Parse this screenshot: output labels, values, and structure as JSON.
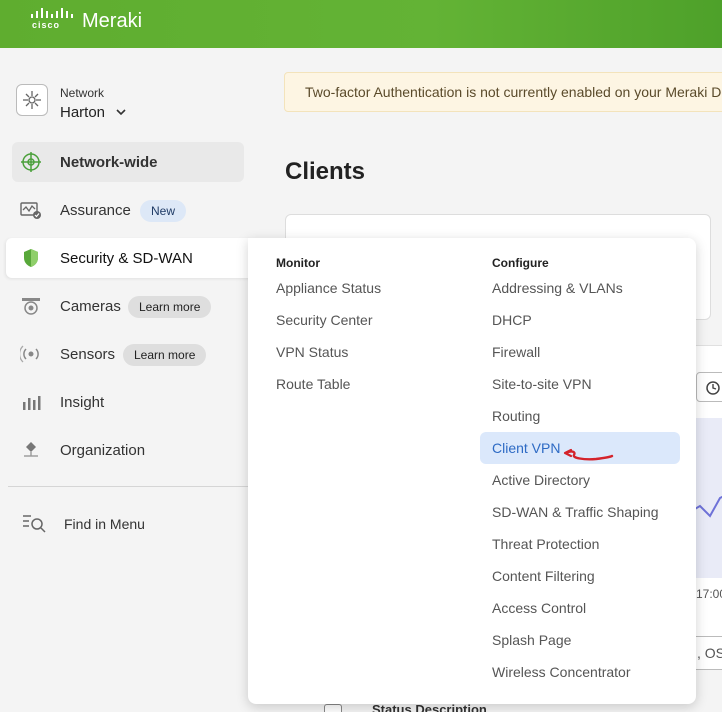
{
  "header": {
    "logo_text": "cisco",
    "brand": "Meraki",
    "colors": {
      "bar": "#5fad2f"
    }
  },
  "sidebar": {
    "network_label": "Network",
    "network_name": "Harton",
    "items": [
      {
        "label": "Network-wide",
        "icon": "network-wide-icon"
      },
      {
        "label": "Assurance",
        "icon": "assurance-icon",
        "badge": "New"
      },
      {
        "label": "Security & SD-WAN",
        "icon": "shield-icon"
      },
      {
        "label": "Cameras",
        "icon": "camera-icon",
        "badge": "Learn more"
      },
      {
        "label": "Sensors",
        "icon": "sensor-icon",
        "badge": "Learn more"
      },
      {
        "label": "Insight",
        "icon": "insight-chart-icon"
      },
      {
        "label": "Organization",
        "icon": "organization-icon"
      }
    ],
    "find_label": "Find in Menu"
  },
  "main": {
    "alert": "Two-factor Authentication is not currently enabled on your Meraki D",
    "title": "Clients",
    "time_tick": "17:00",
    "search_fragment": ", OS",
    "row_fragment": "Status Description"
  },
  "flyout": {
    "monitor_title": "Monitor",
    "monitor": [
      "Appliance Status",
      "Security Center",
      "VPN Status",
      "Route Table"
    ],
    "configure_title": "Configure",
    "configure": [
      "Addressing & VLANs",
      "DHCP",
      "Firewall",
      "Site-to-site VPN",
      "Routing",
      "Client VPN",
      "Active Directory",
      "SD-WAN & Traffic Shaping",
      "Threat Protection",
      "Content Filtering",
      "Access Control",
      "Splash Page",
      "Wireless Concentrator"
    ],
    "highlighted": "Client VPN",
    "colors": {
      "highlight_bg": "#dbe8fb",
      "highlight_text": "#2d6ac4"
    }
  }
}
